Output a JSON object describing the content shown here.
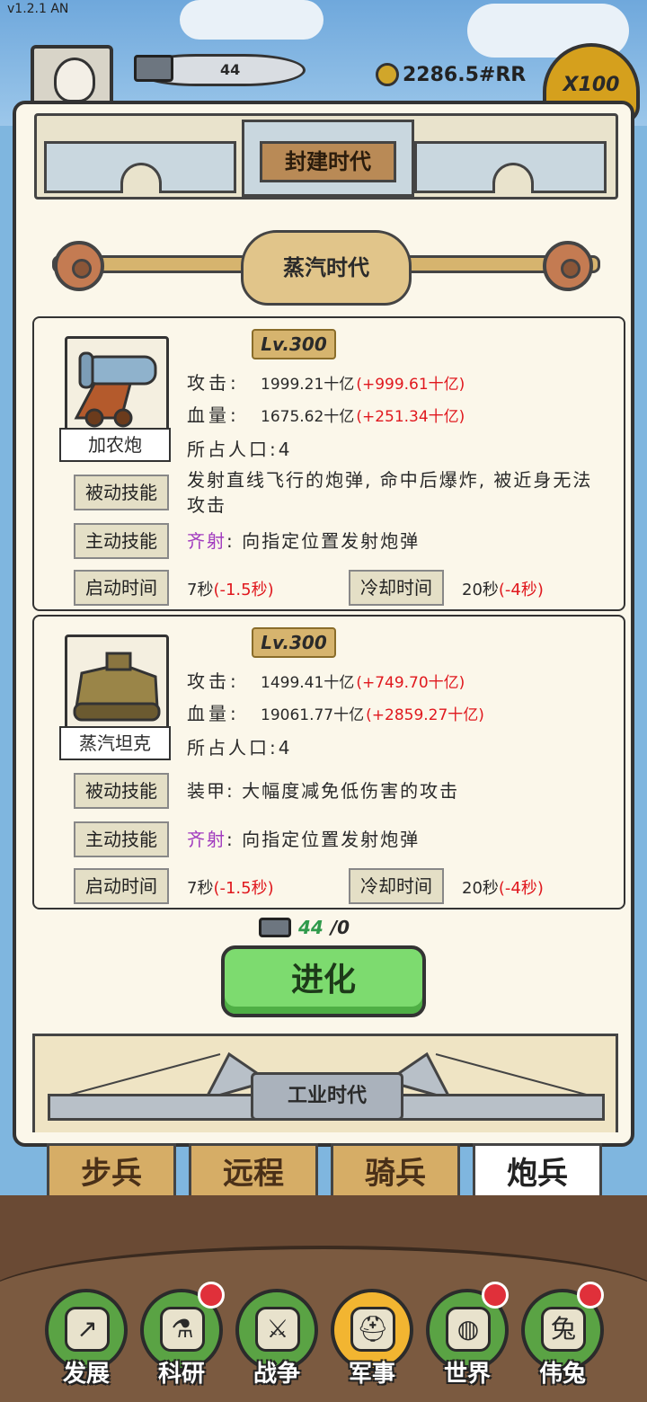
{
  "version": "v1.2.1 AN",
  "hud": {
    "iron": "44",
    "gold": "2286.5#RR",
    "multiplier": "X100"
  },
  "eras": {
    "feudal": "封建时代",
    "steam": "蒸汽时代",
    "industrial": "工业时代"
  },
  "labels": {
    "attack": "攻击:",
    "hp": "血量:",
    "passive": "被动技能",
    "active": "主动技能",
    "start_time": "启动时间",
    "cooldown": "冷却时间"
  },
  "units": [
    {
      "name": "加农炮",
      "level": "Lv.300",
      "attack": "1999.21十亿",
      "attack_bonus": "(+999.61十亿)",
      "hp": "1675.62十亿",
      "hp_bonus": "(+251.34十亿)",
      "population": "所占人口:4",
      "passive": "发射直线飞行的炮弹, 命中后爆炸, 被近身无法攻击",
      "active_name": "齐射",
      "active_desc": ": 向指定位置发射炮弹",
      "start_time": "7秒",
      "start_bonus": "(-1.5秒)",
      "cooldown": "20秒",
      "cooldown_bonus": "(-4秒)",
      "portrait": "cannon-icon"
    },
    {
      "name": "蒸汽坦克",
      "level": "Lv.300",
      "attack": "1499.41十亿",
      "attack_bonus": "(+749.70十亿)",
      "hp": "19061.77十亿",
      "hp_bonus": "(+2859.27十亿)",
      "population": "所占人口:4",
      "passive": "装甲: 大幅度减免低伤害的攻击",
      "active_name": "齐射",
      "active_desc": ": 向指定位置发射炮弹",
      "start_time": "7秒",
      "start_bonus": "(-1.5秒)",
      "cooldown": "20秒",
      "cooldown_bonus": "(-4秒)",
      "portrait": "steam-tank-icon"
    }
  ],
  "evolve": {
    "have": "44",
    "need": "/0",
    "button": "进化"
  },
  "tabs": [
    "步兵",
    "远程",
    "骑兵",
    "炮兵"
  ],
  "nav": [
    {
      "label": "发展",
      "icon": "development-icon",
      "glyph": "↗"
    },
    {
      "label": "科研",
      "icon": "research-flask-icon",
      "glyph": "⚗"
    },
    {
      "label": "战争",
      "icon": "crossed-swords-icon",
      "glyph": "⚔"
    },
    {
      "label": "军事",
      "icon": "military-helmet-icon",
      "glyph": "⛑"
    },
    {
      "label": "世界",
      "icon": "globe-icon",
      "glyph": "◍"
    },
    {
      "label": "伟兔",
      "icon": "rabbit-portrait-icon",
      "glyph": "兔"
    }
  ],
  "colors": {
    "bonus_red": "#e0181e",
    "skill_purple": "#a13bbf",
    "evolve_green": "#7ddb6f",
    "notification_red": "#e0303a"
  }
}
